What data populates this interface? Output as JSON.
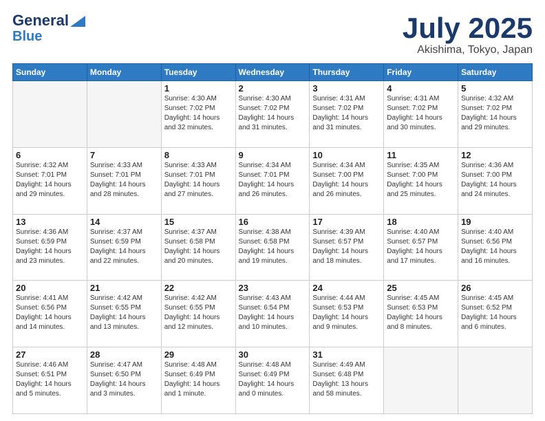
{
  "header": {
    "logo_line1": "General",
    "logo_line2": "Blue",
    "month": "July 2025",
    "location": "Akishima, Tokyo, Japan"
  },
  "days_of_week": [
    "Sunday",
    "Monday",
    "Tuesday",
    "Wednesday",
    "Thursday",
    "Friday",
    "Saturday"
  ],
  "weeks": [
    [
      {
        "day": "",
        "empty": true
      },
      {
        "day": "",
        "empty": true
      },
      {
        "day": "1",
        "sunrise": "4:30 AM",
        "sunset": "7:02 PM",
        "daylight": "14 hours and 32 minutes."
      },
      {
        "day": "2",
        "sunrise": "4:30 AM",
        "sunset": "7:02 PM",
        "daylight": "14 hours and 31 minutes."
      },
      {
        "day": "3",
        "sunrise": "4:31 AM",
        "sunset": "7:02 PM",
        "daylight": "14 hours and 31 minutes."
      },
      {
        "day": "4",
        "sunrise": "4:31 AM",
        "sunset": "7:02 PM",
        "daylight": "14 hours and 30 minutes."
      },
      {
        "day": "5",
        "sunrise": "4:32 AM",
        "sunset": "7:02 PM",
        "daylight": "14 hours and 29 minutes."
      }
    ],
    [
      {
        "day": "6",
        "sunrise": "4:32 AM",
        "sunset": "7:01 PM",
        "daylight": "14 hours and 29 minutes."
      },
      {
        "day": "7",
        "sunrise": "4:33 AM",
        "sunset": "7:01 PM",
        "daylight": "14 hours and 28 minutes."
      },
      {
        "day": "8",
        "sunrise": "4:33 AM",
        "sunset": "7:01 PM",
        "daylight": "14 hours and 27 minutes."
      },
      {
        "day": "9",
        "sunrise": "4:34 AM",
        "sunset": "7:01 PM",
        "daylight": "14 hours and 26 minutes."
      },
      {
        "day": "10",
        "sunrise": "4:34 AM",
        "sunset": "7:00 PM",
        "daylight": "14 hours and 26 minutes."
      },
      {
        "day": "11",
        "sunrise": "4:35 AM",
        "sunset": "7:00 PM",
        "daylight": "14 hours and 25 minutes."
      },
      {
        "day": "12",
        "sunrise": "4:36 AM",
        "sunset": "7:00 PM",
        "daylight": "14 hours and 24 minutes."
      }
    ],
    [
      {
        "day": "13",
        "sunrise": "4:36 AM",
        "sunset": "6:59 PM",
        "daylight": "14 hours and 23 minutes."
      },
      {
        "day": "14",
        "sunrise": "4:37 AM",
        "sunset": "6:59 PM",
        "daylight": "14 hours and 22 minutes."
      },
      {
        "day": "15",
        "sunrise": "4:37 AM",
        "sunset": "6:58 PM",
        "daylight": "14 hours and 20 minutes."
      },
      {
        "day": "16",
        "sunrise": "4:38 AM",
        "sunset": "6:58 PM",
        "daylight": "14 hours and 19 minutes."
      },
      {
        "day": "17",
        "sunrise": "4:39 AM",
        "sunset": "6:57 PM",
        "daylight": "14 hours and 18 minutes."
      },
      {
        "day": "18",
        "sunrise": "4:40 AM",
        "sunset": "6:57 PM",
        "daylight": "14 hours and 17 minutes."
      },
      {
        "day": "19",
        "sunrise": "4:40 AM",
        "sunset": "6:56 PM",
        "daylight": "14 hours and 16 minutes."
      }
    ],
    [
      {
        "day": "20",
        "sunrise": "4:41 AM",
        "sunset": "6:56 PM",
        "daylight": "14 hours and 14 minutes."
      },
      {
        "day": "21",
        "sunrise": "4:42 AM",
        "sunset": "6:55 PM",
        "daylight": "14 hours and 13 minutes."
      },
      {
        "day": "22",
        "sunrise": "4:42 AM",
        "sunset": "6:55 PM",
        "daylight": "14 hours and 12 minutes."
      },
      {
        "day": "23",
        "sunrise": "4:43 AM",
        "sunset": "6:54 PM",
        "daylight": "14 hours and 10 minutes."
      },
      {
        "day": "24",
        "sunrise": "4:44 AM",
        "sunset": "6:53 PM",
        "daylight": "14 hours and 9 minutes."
      },
      {
        "day": "25",
        "sunrise": "4:45 AM",
        "sunset": "6:53 PM",
        "daylight": "14 hours and 8 minutes."
      },
      {
        "day": "26",
        "sunrise": "4:45 AM",
        "sunset": "6:52 PM",
        "daylight": "14 hours and 6 minutes."
      }
    ],
    [
      {
        "day": "27",
        "sunrise": "4:46 AM",
        "sunset": "6:51 PM",
        "daylight": "14 hours and 5 minutes."
      },
      {
        "day": "28",
        "sunrise": "4:47 AM",
        "sunset": "6:50 PM",
        "daylight": "14 hours and 3 minutes."
      },
      {
        "day": "29",
        "sunrise": "4:48 AM",
        "sunset": "6:49 PM",
        "daylight": "14 hours and 1 minute."
      },
      {
        "day": "30",
        "sunrise": "4:48 AM",
        "sunset": "6:49 PM",
        "daylight": "14 hours and 0 minutes."
      },
      {
        "day": "31",
        "sunrise": "4:49 AM",
        "sunset": "6:48 PM",
        "daylight": "13 hours and 58 minutes."
      },
      {
        "day": "",
        "empty": true
      },
      {
        "day": "",
        "empty": true
      }
    ]
  ]
}
